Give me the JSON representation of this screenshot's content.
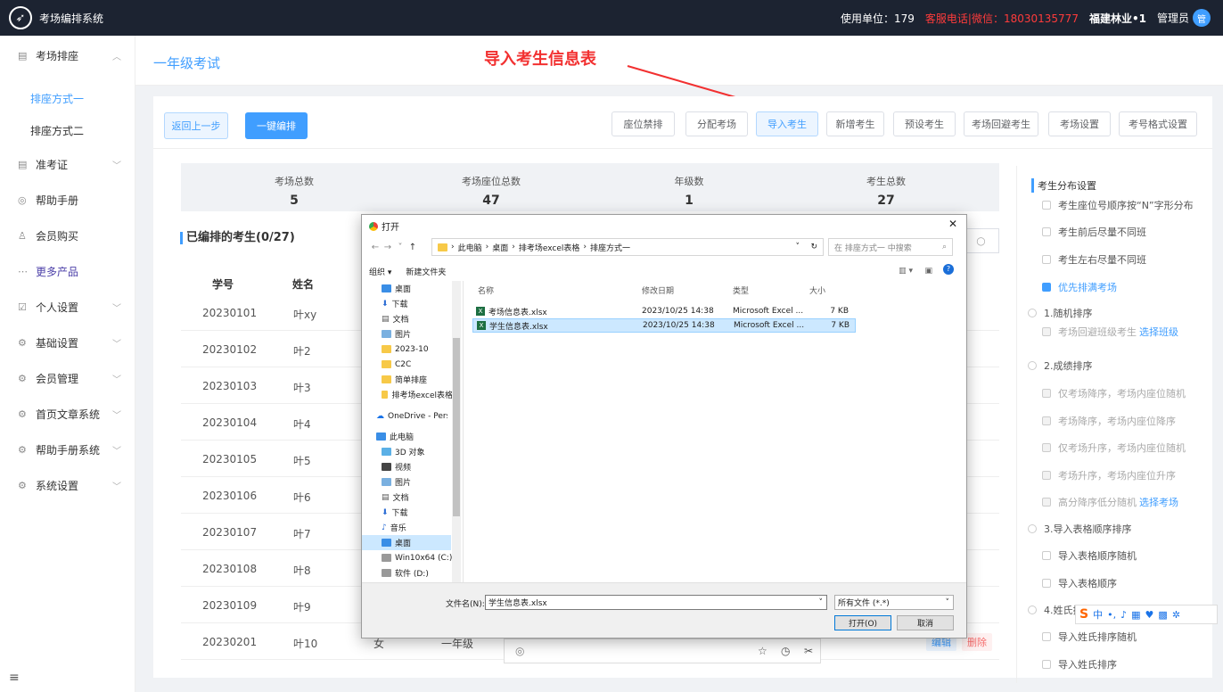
{
  "app": {
    "title": "考场编排系统",
    "logo": "rocket-icon"
  },
  "topbar": {
    "unit": "使用单位：179",
    "hotline": "客服电话|微信：18030135777",
    "company": "福建林业•1",
    "role": "管理员",
    "avatar": "管"
  },
  "sidebar": {
    "items": [
      {
        "label": "考场排座",
        "icon": "doc-icon"
      },
      {
        "label": "准考证",
        "icon": "doc-icon"
      },
      {
        "label": "帮助手册",
        "icon": "help-icon"
      },
      {
        "label": "会员购买",
        "icon": "user-icon"
      },
      {
        "label": "更多产品",
        "icon": "more-icon"
      },
      {
        "label": "个人设置",
        "icon": "edit-icon"
      },
      {
        "label": "基础设置",
        "icon": "gear-icon"
      },
      {
        "label": "会员管理",
        "icon": "gear-icon"
      },
      {
        "label": "首页文章系统",
        "icon": "gear-icon"
      },
      {
        "label": "帮助手册系统",
        "icon": "gear-icon"
      },
      {
        "label": "系统设置",
        "icon": "gear-icon"
      }
    ],
    "subitems": [
      "排座方式一",
      "排座方式二"
    ]
  },
  "page": {
    "title": "一年级考试",
    "annotation": "导入考生信息表"
  },
  "toolbar": {
    "back": "返回上一步",
    "auto": "一键编排",
    "buttons": [
      "座位禁排",
      "分配考场",
      "导入考生",
      "新增考生",
      "预设考生",
      "考场回避考生",
      "考场设置",
      "考号格式设置"
    ]
  },
  "stats": [
    {
      "k": "考场总数",
      "v": "5"
    },
    {
      "k": "考场座位总数",
      "v": "47"
    },
    {
      "k": "年级数",
      "v": "1"
    },
    {
      "k": "考生总数",
      "v": "27"
    }
  ],
  "table": {
    "title": "已编排的考生(0/27)",
    "headers": [
      "学号",
      "姓名"
    ],
    "rows": [
      {
        "id": "20230101",
        "name": "叶xy"
      },
      {
        "id": "20230102",
        "name": "叶2"
      },
      {
        "id": "20230103",
        "name": "叶3"
      },
      {
        "id": "20230104",
        "name": "叶4"
      },
      {
        "id": "20230105",
        "name": "叶5"
      },
      {
        "id": "20230106",
        "name": "叶6"
      },
      {
        "id": "20230107",
        "name": "叶7"
      },
      {
        "id": "20230108",
        "name": "叶8"
      },
      {
        "id": "20230109",
        "name": "叶9"
      },
      {
        "id": "20230201",
        "name": "叶10",
        "gender": "女",
        "grade": "一年级",
        "edit": "编辑",
        "del": "删除"
      }
    ]
  },
  "right_panel": {
    "title": "考生分布设置",
    "options": [
      "考生座位号顺序按“N”字形分布",
      "考生前后尽量不同班",
      "考生左右尽量不同班",
      "优先排满考场",
      "1.随机排序",
      "考场回避班级考生",
      "选择班级",
      "2.成绩排序",
      "仅考场降序，考场内座位随机",
      "考场降序，考场内座位降序",
      "仅考场升序，考场内座位随机",
      "考场升序，考场内座位升序",
      "高分降序低分随机",
      "选择考场",
      "3.导入表格顺序排序",
      "导入表格顺序随机",
      "导入表格顺序",
      "4.姓氏排序",
      "导入姓氏排序随机",
      "导入姓氏排序"
    ]
  },
  "ime": {
    "label": "中"
  },
  "dialog": {
    "title": "打开",
    "path": [
      "此电脑",
      "桌面",
      "排考场excel表格",
      "排座方式一"
    ],
    "search": "在 排座方式一 中搜索",
    "organize": "组织 ▾",
    "newfolder": "新建文件夹",
    "nav": [
      "桌面",
      "下载",
      "文档",
      "图片",
      "2023-10",
      "C2C",
      "简单排座",
      "排考场excel表格",
      "OneDrive - Pers",
      "此电脑",
      "3D 对象",
      "视频",
      "图片",
      "文档",
      "下载",
      "音乐",
      "桌面",
      "Win10x64 (C:)",
      "软件 (D:)"
    ],
    "columns": [
      "名称",
      "修改日期",
      "类型",
      "大小"
    ],
    "files": [
      {
        "name": "考场信息表.xlsx",
        "date": "2023/10/25 14:38",
        "type": "Microsoft Excel ...",
        "size": "7 KB"
      },
      {
        "name": "学生信息表.xlsx",
        "date": "2023/10/25 14:38",
        "type": "Microsoft Excel ...",
        "size": "7 KB"
      }
    ],
    "filename_label": "文件名(N):",
    "filename": "学生信息表.xlsx",
    "filetype": "所有文件 (*.*)",
    "open": "打开(O)",
    "cancel": "取消"
  }
}
